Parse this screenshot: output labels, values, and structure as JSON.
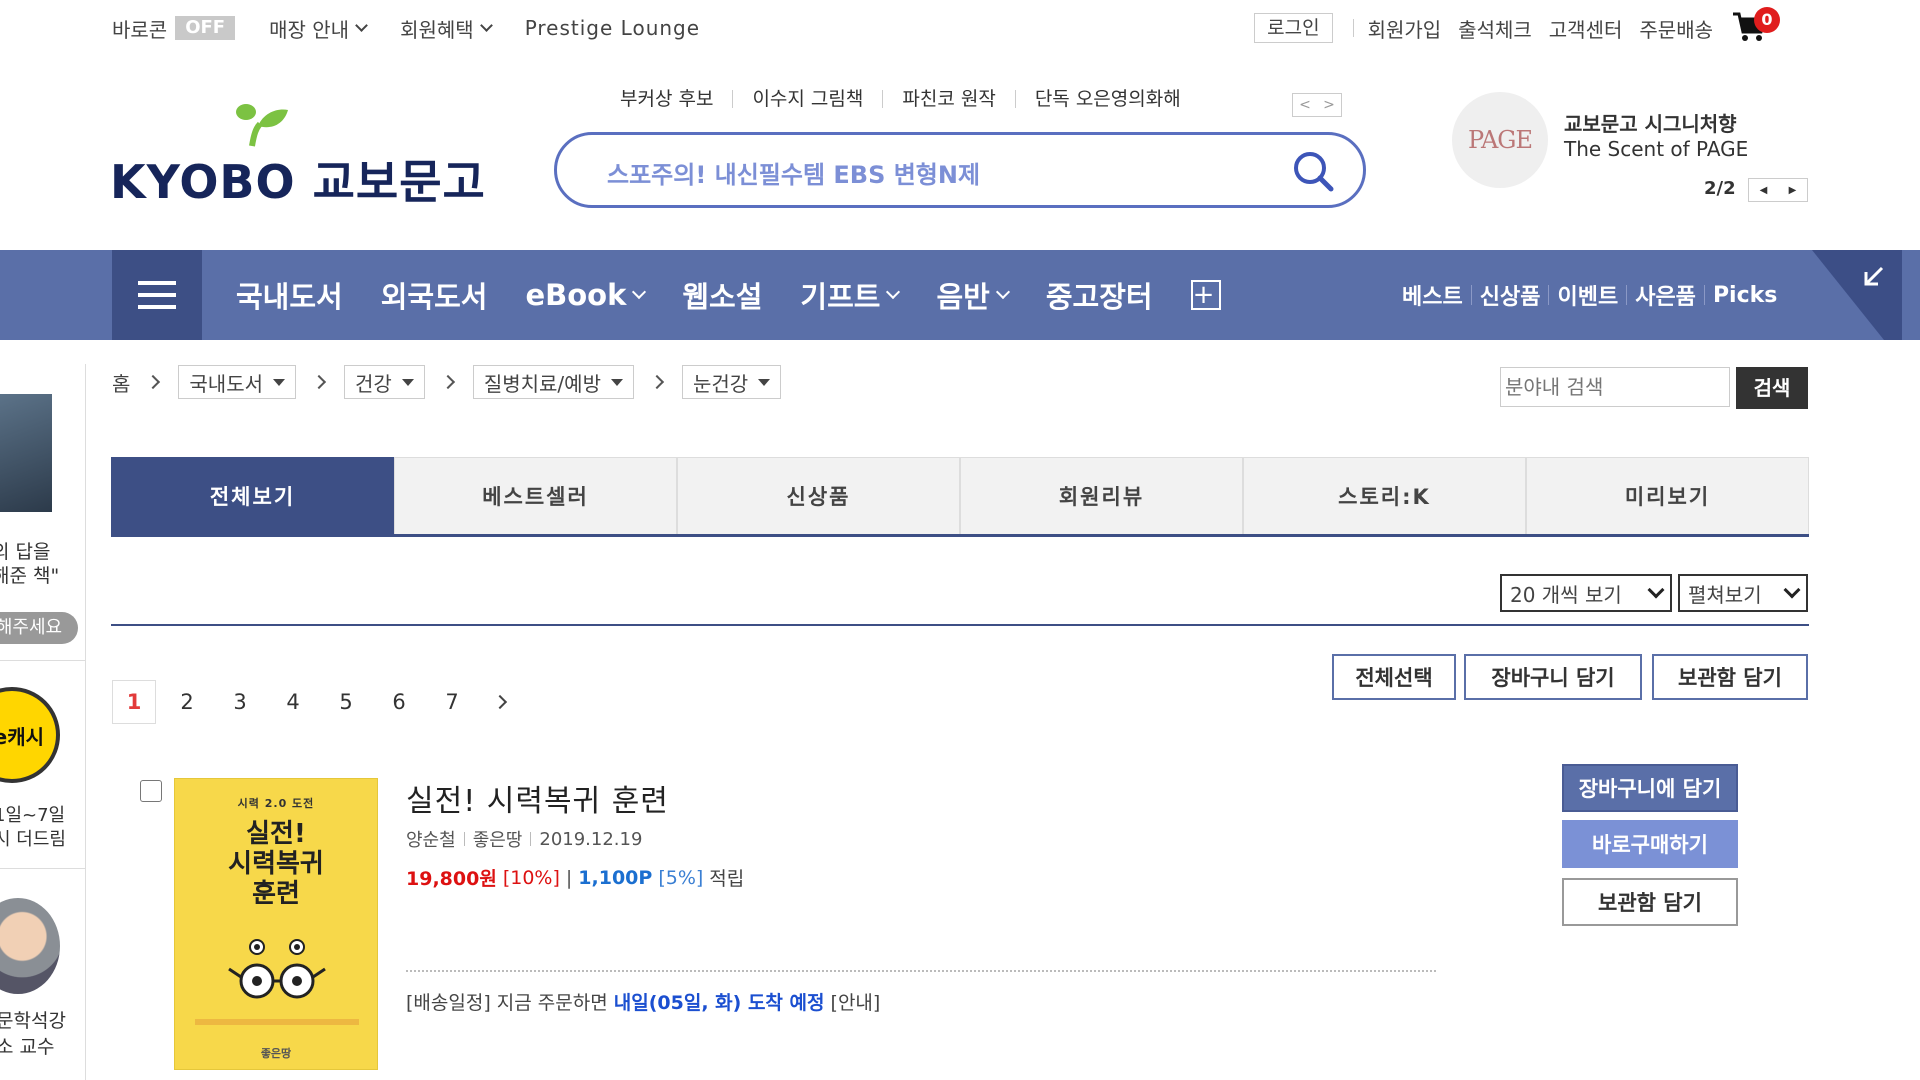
{
  "util": {
    "baro_label": "바로콘",
    "baro_state": "OFF",
    "store_info": "매장 안내",
    "benefits": "회원혜택",
    "prestige": "Prestige Lounge",
    "login": "로그인",
    "join": "회원가입",
    "attendance": "출석체크",
    "customer_center": "고객센터",
    "order_delivery": "주문배송",
    "cart_count": "0"
  },
  "logo": {
    "text": "KYOBO 교보문고"
  },
  "keywords": [
    "부커상 후보",
    "이수지 그림책",
    "파친코 원작",
    "단독 오은영의화해"
  ],
  "keyword_arrows": {
    "prev": "<",
    "next": ">"
  },
  "search": {
    "text": "스포주의! 내신필수템 EBS 변형N제"
  },
  "promo": {
    "badge": "PAGE",
    "title": "교보문고 시그니처향",
    "subtitle": "The Scent of PAGE",
    "page": "2/2",
    "prev": "◀",
    "next": "▶"
  },
  "nav": {
    "items": [
      "국내도서",
      "외국도서",
      "eBook",
      "웹소설",
      "기프트",
      "음반",
      "중고장터"
    ],
    "plus": "+",
    "links": [
      "베스트",
      "신상품",
      "이벤트",
      "사은품",
      "Picks"
    ]
  },
  "sidebar": {
    "text1_line1": "의 답을",
    "text1_line2": "해준 책\"",
    "button": "해주세요",
    "coin_label": "e캐시",
    "text2_line1": "1일~7일",
    "text2_line2": "시 더드림",
    "text3_line1": "문학석강",
    "text3_line2": "소 교수"
  },
  "breadcrumb": {
    "home": "홈",
    "levels": [
      "국내도서",
      "건강",
      "질병치료/예방",
      "눈건강"
    ],
    "search_placeholder": "분야내 검색",
    "search_button": "검색"
  },
  "tabs": [
    "전체보기",
    "베스트셀러",
    "신상품",
    "회원리뷰",
    "스토리:K",
    "미리보기"
  ],
  "view": {
    "per_page": "20 개씩 보기",
    "mode": "펼쳐보기"
  },
  "pagination": {
    "pages": [
      "1",
      "2",
      "3",
      "4",
      "5",
      "6",
      "7"
    ],
    "current": "1"
  },
  "actions": {
    "select_all": "전체선택",
    "add_cart": "장바구니 담기",
    "add_keep": "보관함 담기"
  },
  "product": {
    "cover_top": "시력 2.0 도전",
    "cover_title_1": "실전!",
    "cover_title_2": "시력복귀",
    "cover_title_3": "훈련",
    "cover_publisher": "좋은땅",
    "title": "실전! 시력복귀 훈련",
    "author": "양순철",
    "publisher": "좋은땅",
    "date": "2019.12.19",
    "price": "19,800원",
    "discount": "[10%]",
    "sep": "|",
    "points": "1,100P",
    "points_rate": "[5%]",
    "points_suffix": "적립",
    "delivery_prefix": "[배송일정] 지금 주문하면",
    "delivery_date": "내일(05일, 화) 도착 예정",
    "delivery_suffix": "[안내]",
    "btn_cart": "장바구니에 담기",
    "btn_buy": "바로구매하기",
    "btn_keep": "보관함 담기"
  }
}
